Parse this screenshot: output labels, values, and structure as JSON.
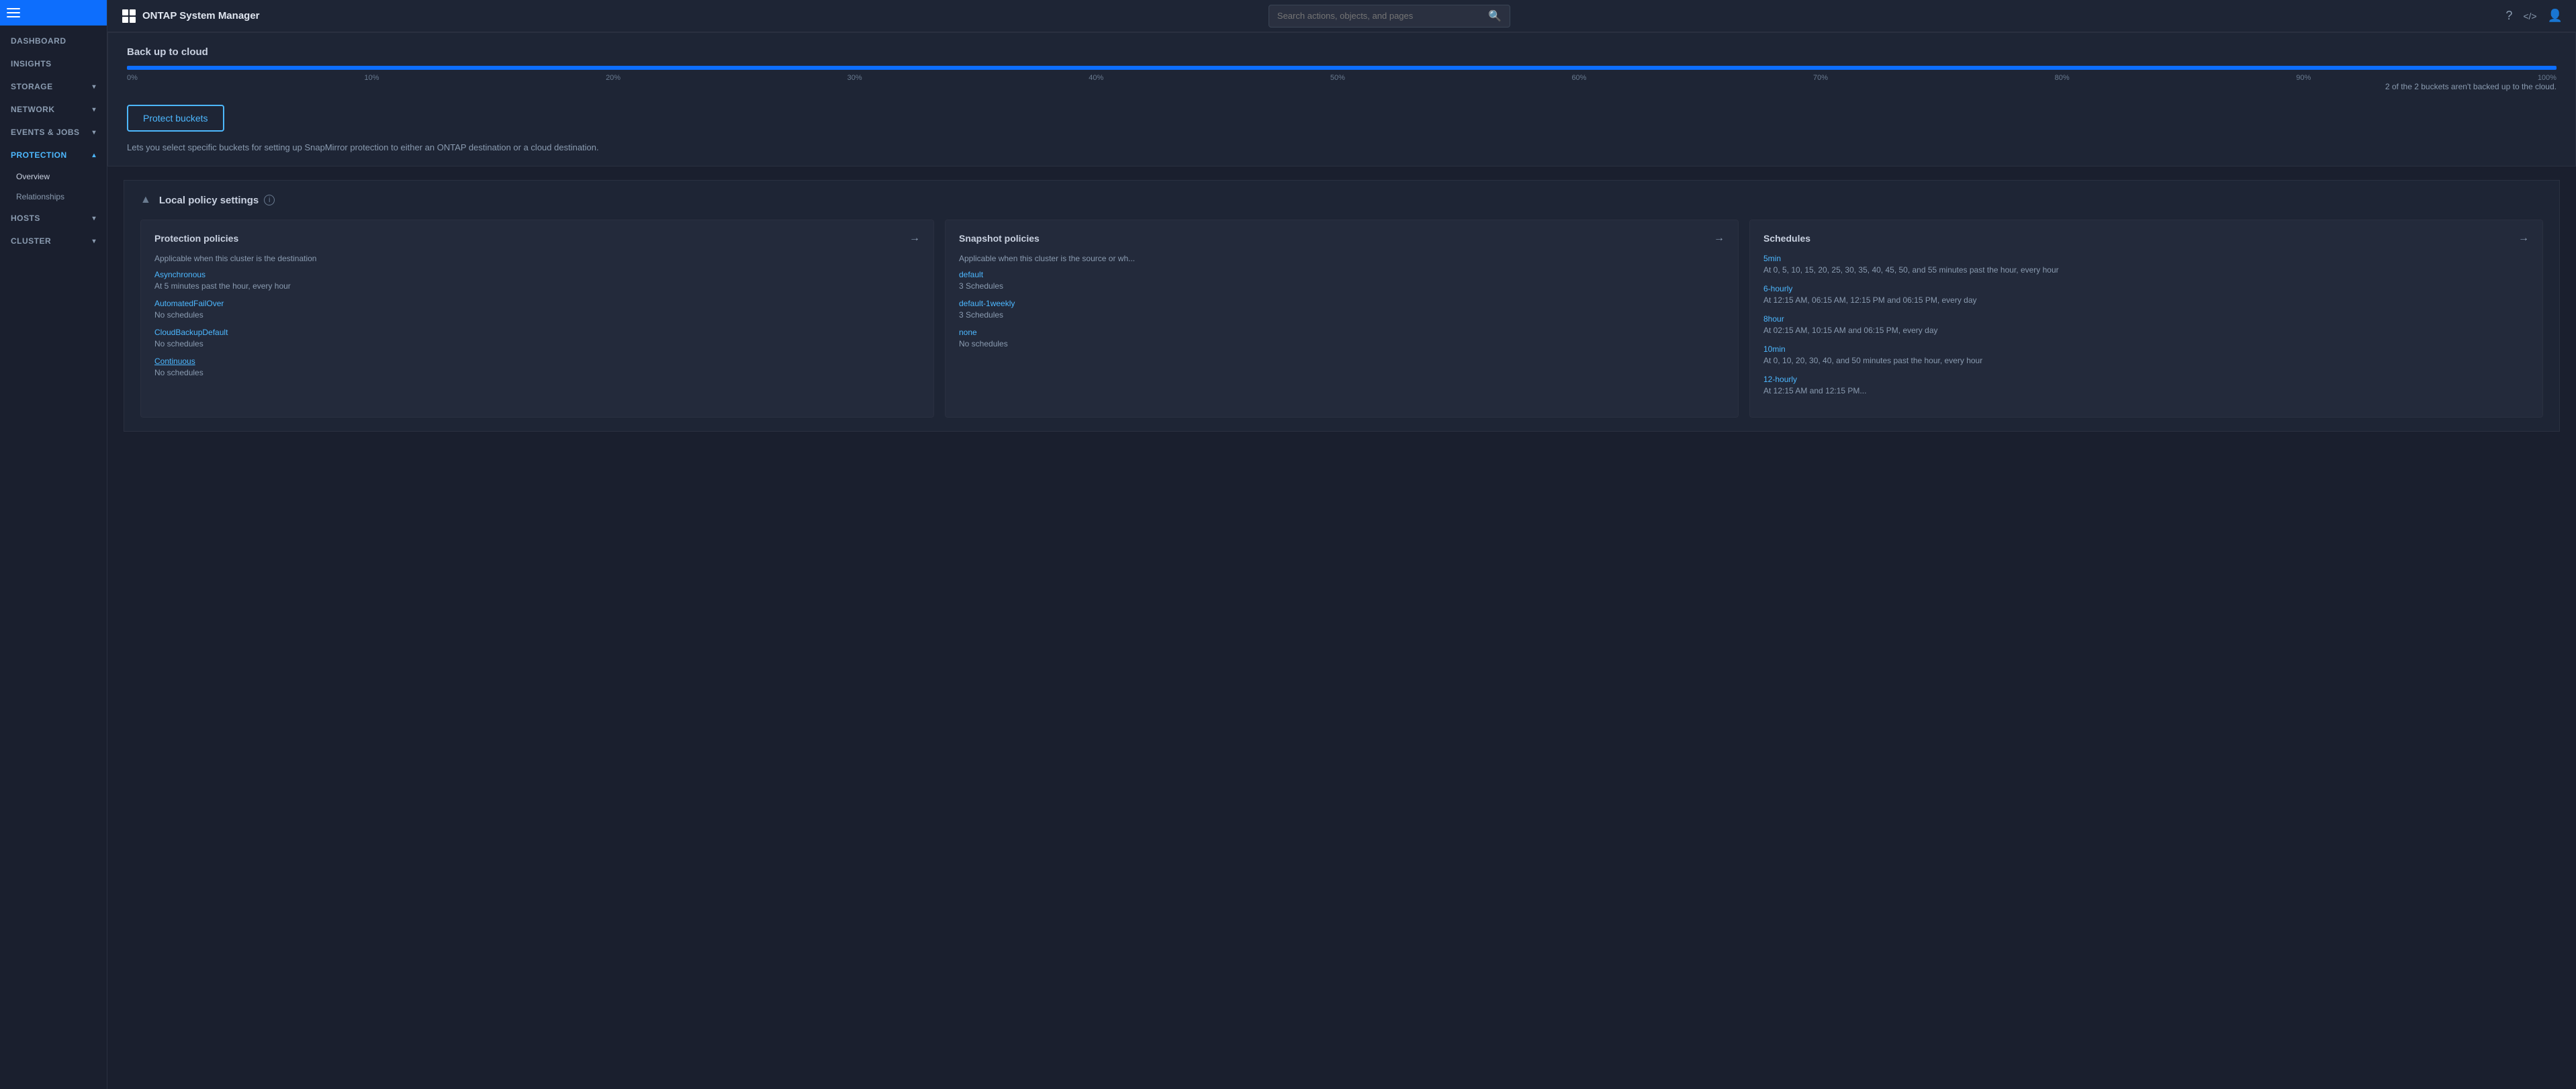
{
  "app": {
    "title": "ONTAP System Manager",
    "logo_alt": "NetApp"
  },
  "topbar": {
    "search_placeholder": "Search actions, objects, and pages",
    "help_icon": "?",
    "code_icon": "</>",
    "user_icon": "👤"
  },
  "sidebar": {
    "items": [
      {
        "id": "dashboard",
        "label": "DASHBOARD",
        "has_children": false,
        "active": false
      },
      {
        "id": "insights",
        "label": "INSIGHTS",
        "has_children": false,
        "active": false
      },
      {
        "id": "storage",
        "label": "STORAGE",
        "has_children": true,
        "active": false
      },
      {
        "id": "network",
        "label": "NETWORK",
        "has_children": true,
        "active": false
      },
      {
        "id": "events-jobs",
        "label": "EVENTS & JOBS",
        "has_children": true,
        "active": false
      },
      {
        "id": "protection",
        "label": "PROTECTION",
        "has_children": true,
        "active": true
      },
      {
        "id": "hosts",
        "label": "HOSTS",
        "has_children": true,
        "active": false
      },
      {
        "id": "cluster",
        "label": "CLUSTER",
        "has_children": true,
        "active": false
      }
    ],
    "protection_sub_items": [
      {
        "id": "overview",
        "label": "Overview",
        "active": true
      },
      {
        "id": "relationships",
        "label": "Relationships",
        "active": false
      }
    ]
  },
  "backup_section": {
    "title": "Back up to cloud",
    "progress_pct": 100,
    "info_text": "2 of the  2 buckets aren't backed up to the cloud.",
    "progress_labels": [
      "0%",
      "10%",
      "20%",
      "30%",
      "40%",
      "50%",
      "60%",
      "70%",
      "80%",
      "90%",
      "100%"
    ]
  },
  "protect_buckets": {
    "button_label": "Protect buckets",
    "description": "Lets you select specific buckets for setting up SnapMirror protection to either an ONTAP destination or a cloud destination."
  },
  "local_policy": {
    "title": "Local policy settings",
    "collapse_icon": "▲",
    "info_icon": "i"
  },
  "protection_policies": {
    "title": "Protection policies",
    "arrow": "→",
    "subtitle": "Applicable when this cluster is the destination",
    "items": [
      {
        "name": "Asynchronous",
        "description": "At 5 minutes past the hour, every hour"
      },
      {
        "name": "AutomatedFailOver",
        "description": "No schedules"
      },
      {
        "name": "CloudBackupDefault",
        "description": "No schedules"
      },
      {
        "name": "Continuous",
        "description": "No schedules",
        "hovered": true
      }
    ]
  },
  "snapshot_policies": {
    "title": "Snapshot policies",
    "arrow": "→",
    "subtitle": "Applicable when this cluster is the source or wh...",
    "items": [
      {
        "name": "default",
        "description": "3 Schedules"
      },
      {
        "name": "default-1weekly",
        "description": "3 Schedules"
      },
      {
        "name": "none",
        "description": "No schedules"
      }
    ]
  },
  "schedules": {
    "title": "Schedules",
    "arrow": "→",
    "items": [
      {
        "name": "5min",
        "description": "At 0, 5, 10, 15, 20, 25, 30, 35, 40, 45, 50, and 55 minutes past the hour, every hour"
      },
      {
        "name": "6-hourly",
        "description": "At 12:15 AM, 06:15 AM, 12:15 PM and 06:15 PM, every day"
      },
      {
        "name": "8hour",
        "description": "At 02:15 AM, 10:15 AM and 06:15 PM, every day"
      },
      {
        "name": "10min",
        "description": "At 0, 10, 20, 30, 40, and 50 minutes past the hour, every hour"
      },
      {
        "name": "12-hourly",
        "description": "At 12:15 AM and 12:15 PM..."
      }
    ]
  }
}
